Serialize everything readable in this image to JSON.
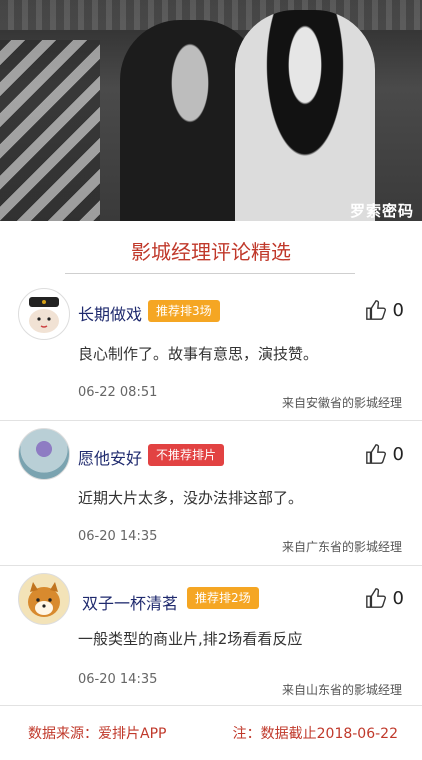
{
  "hero": {
    "poster_text": "罗索密码"
  },
  "section_title": "影城经理评论精选",
  "reviews": [
    {
      "name": "长期做戏",
      "badge": "推荐排3场",
      "badge_type": "rec",
      "likes": "0",
      "text": "良心制作了。故事有意思，演技赞。",
      "date": "06-22 08:51",
      "source": "来自安徽省的影城经理"
    },
    {
      "name": "愿他安好",
      "badge": "不推荐排片",
      "badge_type": "no",
      "likes": "0",
      "text": "近期大片太多，没办法排这部了。",
      "date": "06-20 14:35",
      "source": "来自广东省的影城经理"
    },
    {
      "name": "双子一杯清茗",
      "badge": "推荐排2场",
      "badge_type": "rec",
      "likes": "0",
      "text": "一般类型的商业片,排2场看看反应",
      "date": "06-20 14:35",
      "source": "来自山东省的影城经理"
    }
  ],
  "footer": {
    "data_source": "数据来源：爱排片APP",
    "note": "注：数据截止2018-06-22"
  },
  "colors": {
    "title_red": "#c0392b",
    "badge_recommend": "#f5a623",
    "badge_not_recommend": "#e24242",
    "name_blue": "#1f2a6e"
  }
}
